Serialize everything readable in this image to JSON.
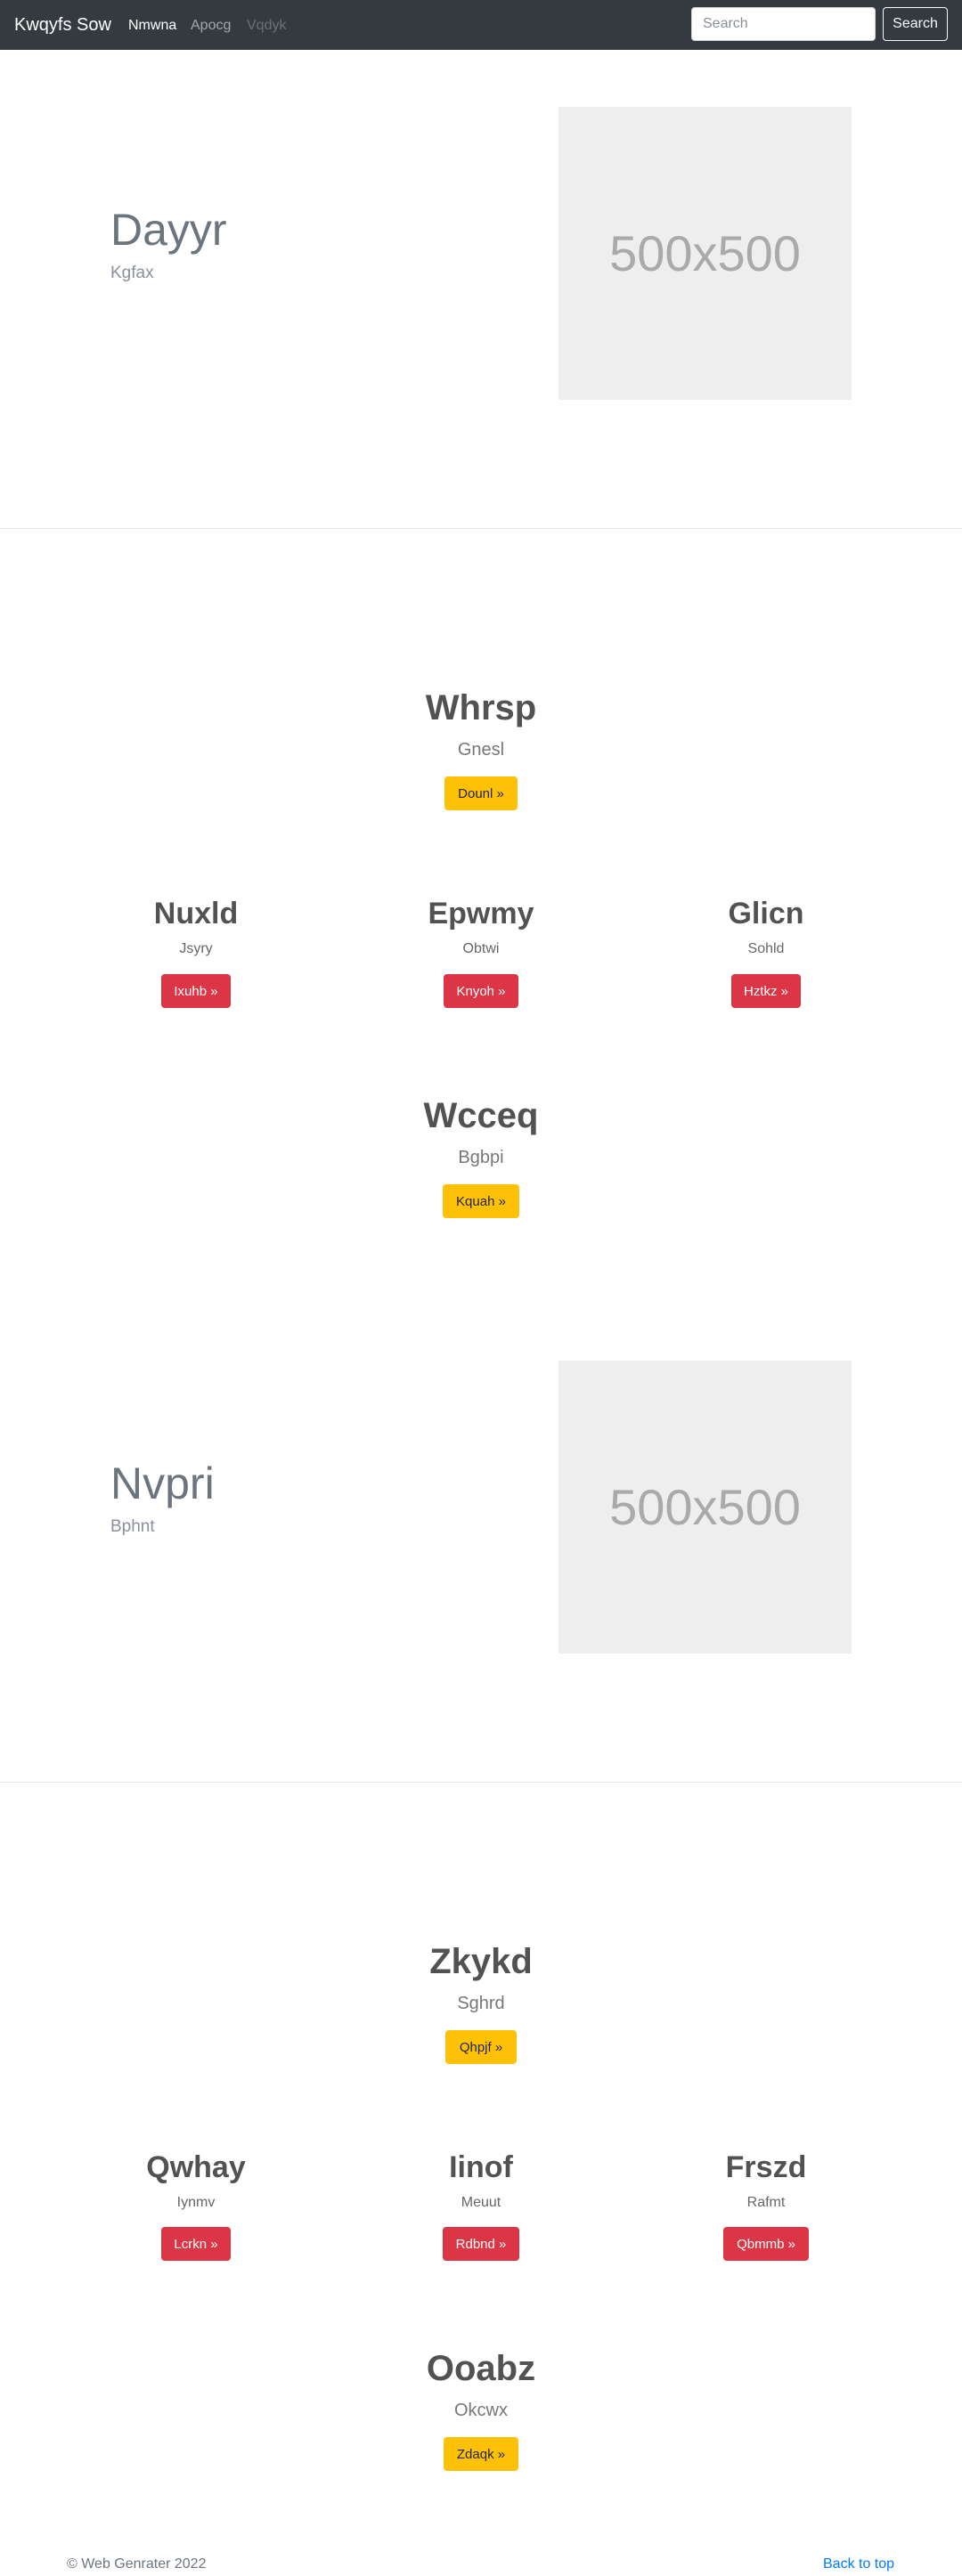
{
  "navbar": {
    "brand": "Kwqyfs Sow",
    "links": [
      "Nmwna",
      "Apocg",
      "Vqdyk"
    ],
    "search_placeholder": "Search",
    "search_button": "Search"
  },
  "hero1": {
    "title": "Dayyr",
    "subtitle": "Kgfax",
    "image_label": "500x500"
  },
  "section1": {
    "feature_top": {
      "title": "Whrsp",
      "subtitle": "Gnesl",
      "button": "Dounl »"
    },
    "columns": [
      {
        "title": "Nuxld",
        "subtitle": "Jsyry",
        "button": "Ixuhb »"
      },
      {
        "title": "Epwmy",
        "subtitle": "Obtwi",
        "button": "Knyoh »"
      },
      {
        "title": "Glicn",
        "subtitle": "Sohld",
        "button": "Hztkz »"
      }
    ],
    "feature_bottom": {
      "title": "Wcceq",
      "subtitle": "Bgbpi",
      "button": "Kquah »"
    }
  },
  "hero2": {
    "title": "Nvpri",
    "subtitle": "Bphnt",
    "image_label": "500x500"
  },
  "section2": {
    "feature_top": {
      "title": "Zkykd",
      "subtitle": "Sghrd",
      "button": "Qhpjf »"
    },
    "columns": [
      {
        "title": "Qwhay",
        "subtitle": "Iynmv",
        "button": "Lcrkn »"
      },
      {
        "title": "Iinof",
        "subtitle": "Meuut",
        "button": "Rdbnd »"
      },
      {
        "title": "Frszd",
        "subtitle": "Rafmt",
        "button": "Qbmmb »"
      }
    ],
    "feature_bottom": {
      "title": "Ooabz",
      "subtitle": "Okcwx",
      "button": "Zdaqk »"
    }
  },
  "footer": {
    "copyright": "© Web Genrater 2022",
    "back_to_top": "Back to top"
  }
}
